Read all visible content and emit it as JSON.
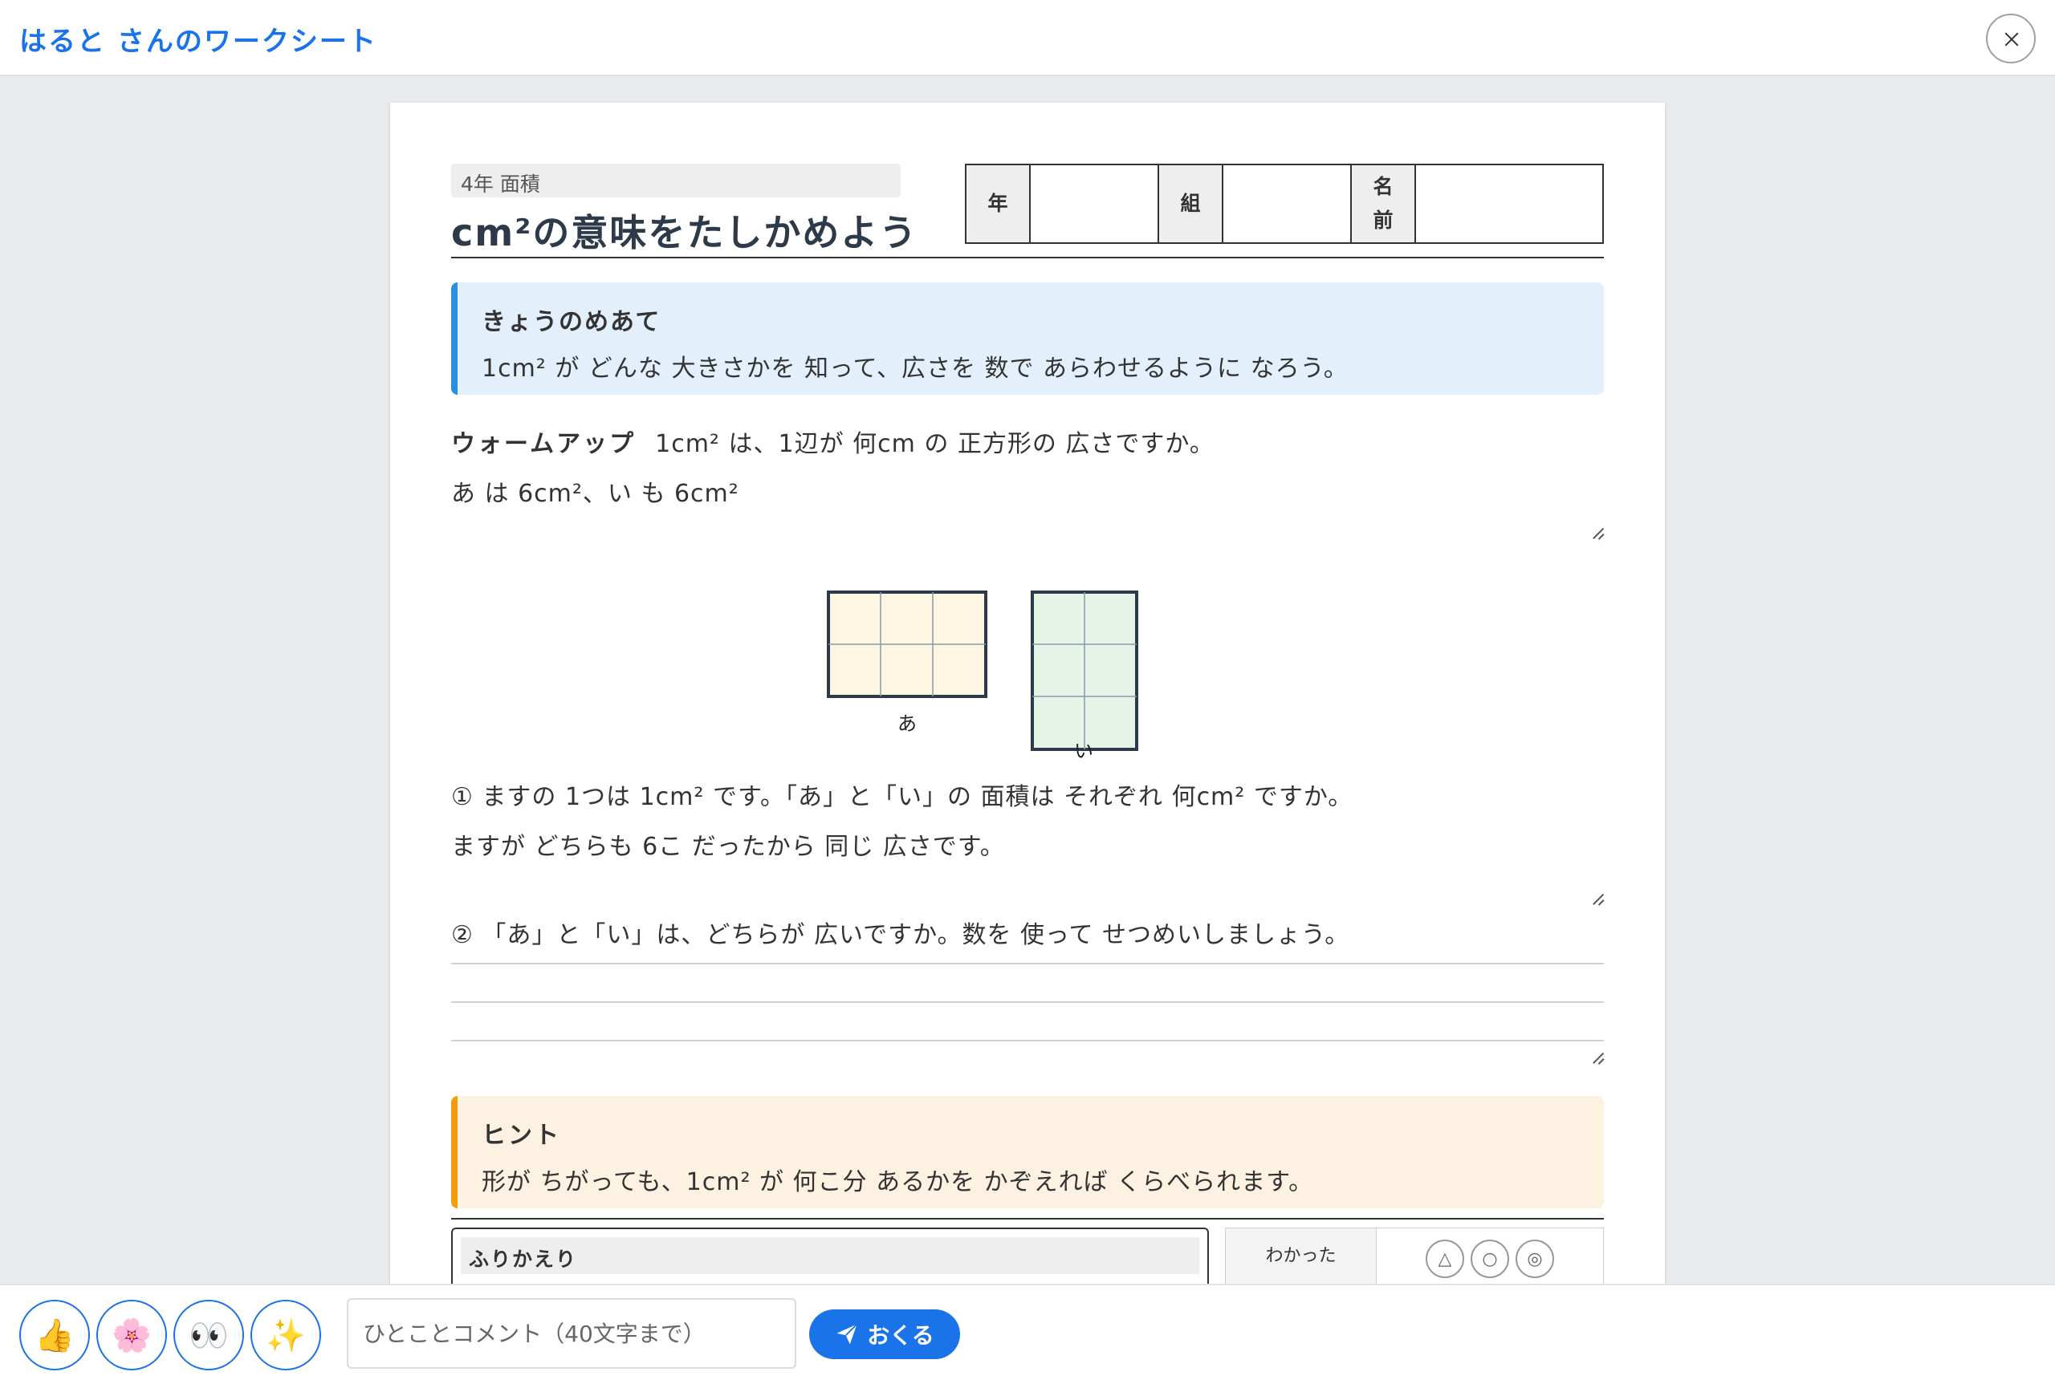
{
  "header": {
    "title": "はると さんのワークシート"
  },
  "worksheet": {
    "unit": "4年 面積",
    "title": "cm²の意味をたしかめよう",
    "name_table": {
      "year_label": "年",
      "class_label": "組",
      "name_label": "名\n前"
    },
    "goal": {
      "heading": "きょうのめあて",
      "text": "1cm² が どんな 大きさかを 知って、広さを 数で あらわせるように なろう。"
    },
    "warmup": {
      "label": "ウォームアップ",
      "question": "1cm² は、1辺が 何cm の 正方形の 広さですか。",
      "answer": "あ は 6cm²、い も 6cm²"
    },
    "figures": {
      "a_label": "あ",
      "i_label": "い"
    },
    "q1": {
      "question": "① ますの 1つは 1cm² です。「あ」と「い」の 面積は それぞれ 何cm² ですか。",
      "answer": "ますが どちらも 6こ だったから 同じ 広さです。"
    },
    "q2": {
      "question": "② 「あ」と「い」は、どちらが 広いですか。数を 使って せつめいしましょう。"
    },
    "hint": {
      "heading": "ヒント",
      "text": "形が ちがっても、1cm² が 何こ分 あるかを かぞえれば くらべられます。"
    },
    "reflection": {
      "heading": "ふりかえり"
    },
    "evaluation": {
      "label": "わかった",
      "marks": [
        "△",
        "○",
        "◎"
      ]
    }
  },
  "bottom": {
    "reactions": [
      "👍",
      "🌸",
      "👀",
      "✨"
    ],
    "comment_placeholder": "ひとことコメント（40文字まで）",
    "send_label": "おくる"
  },
  "colors": {
    "accent": "#1a73e8",
    "goal_bg": "#e3f0fb",
    "goal_border": "#2b8ee0",
    "hint_bg": "#fdf1e1",
    "hint_border": "#f39c12",
    "fig_a_fill": "#fdf6e3",
    "fig_i_fill": "#e5f4e7"
  }
}
